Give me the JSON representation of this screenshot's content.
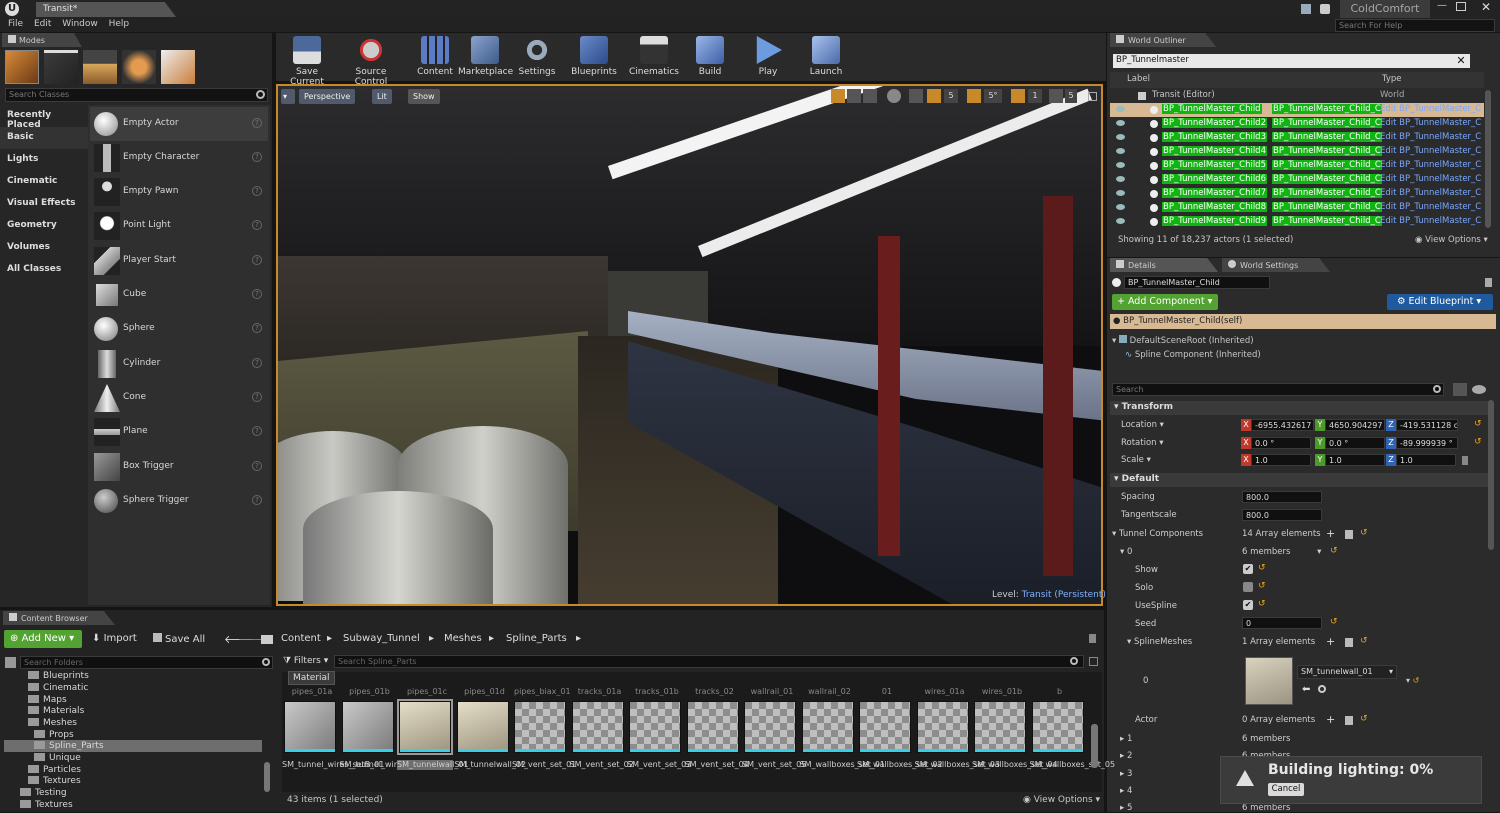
{
  "app": {
    "tab_title": "Transit*",
    "project_name": "ColdComfort",
    "search_help_placeholder": "Search For Help"
  },
  "menu": [
    "File",
    "Edit",
    "Window",
    "Help"
  ],
  "modes": {
    "tab": "Modes",
    "search_placeholder": "Search Classes",
    "categories": [
      "Recently Placed",
      "Basic",
      "Lights",
      "Cinematic",
      "Visual Effects",
      "Geometry",
      "Volumes",
      "All Classes"
    ],
    "selected_category": "Basic",
    "actors": [
      "Empty Actor",
      "Empty Character",
      "Empty Pawn",
      "Point Light",
      "Player Start",
      "Cube",
      "Sphere",
      "Cylinder",
      "Cone",
      "Plane",
      "Box Trigger",
      "Sphere Trigger"
    ]
  },
  "toolbar": [
    "Save Current",
    "Source Control",
    "Content",
    "Marketplace",
    "Settings",
    "Blueprints",
    "Cinematics",
    "Build",
    "Play",
    "Launch"
  ],
  "viewport": {
    "perspective": "Perspective",
    "lit": "Lit",
    "show": "Show",
    "grid_snap": "5",
    "rot_snap": "5°",
    "scale_snap": "1",
    "cam_speed": "5",
    "level_label": "Level:",
    "level_name": "Transit (Persistent)"
  },
  "outliner": {
    "tab": "World Outliner",
    "search_value": "BP_Tunnelmaster",
    "col_label": "Label",
    "col_type": "Type",
    "root_label": "Transit (Editor)",
    "root_type": "World",
    "rows": [
      {
        "name": "BP_TunnelMaster_Child",
        "type": "BP_TunnelMaster_Child_C",
        "edit": "Edit BP_TunnelMaster_C"
      },
      {
        "name": "BP_TunnelMaster_Child2",
        "type": "BP_TunnelMaster_Child_C",
        "edit": "Edit BP_TunnelMaster_C"
      },
      {
        "name": "BP_TunnelMaster_Child3",
        "type": "BP_TunnelMaster_Child_C",
        "edit": "Edit BP_TunnelMaster_C"
      },
      {
        "name": "BP_TunnelMaster_Child4",
        "type": "BP_TunnelMaster_Child_C",
        "edit": "Edit BP_TunnelMaster_C"
      },
      {
        "name": "BP_TunnelMaster_Child5",
        "type": "BP_TunnelMaster_Child_C",
        "edit": "Edit BP_TunnelMaster_C"
      },
      {
        "name": "BP_TunnelMaster_Child6",
        "type": "BP_TunnelMaster_Child_C",
        "edit": "Edit BP_TunnelMaster_C"
      },
      {
        "name": "BP_TunnelMaster_Child7",
        "type": "BP_TunnelMaster_Child_C",
        "edit": "Edit BP_TunnelMaster_C"
      },
      {
        "name": "BP_TunnelMaster_Child8",
        "type": "BP_TunnelMaster_Child_C",
        "edit": "Edit BP_TunnelMaster_C"
      },
      {
        "name": "BP_TunnelMaster_Child9",
        "type": "BP_TunnelMaster_Child_C",
        "edit": "Edit BP_TunnelMaster_C"
      }
    ],
    "status": "Showing 11 of 18,237 actors (1 selected)",
    "view_options": "View Options"
  },
  "details": {
    "tab": "Details",
    "tab2": "World Settings",
    "actor_name": "BP_TunnelMaster_Child",
    "add_component": "+ Add Component",
    "edit_blueprint": "Edit Blueprint",
    "self_label": "BP_TunnelMaster_Child(self)",
    "components": [
      "DefaultSceneRoot (Inherited)",
      "Spline Component (Inherited)"
    ],
    "search_placeholder": "Search",
    "transform_header": "Transform",
    "location_label": "Location",
    "rotation_label": "Rotation",
    "scale_label": "Scale",
    "location": [
      "-6955.432617",
      "4650.904297 c",
      "-419.531128 cr"
    ],
    "rotation": [
      "0.0 °",
      "0.0 °",
      "-89.999939 °"
    ],
    "scale": [
      "1.0",
      "1.0",
      "1.0"
    ],
    "default_header": "Default",
    "spacing_label": "Spacing",
    "spacing": "800.0",
    "tangentscale_label": "Tangentscale",
    "tangentscale": "800.0",
    "tunnel_components_label": "Tunnel Components",
    "tunnel_components_value": "14 Array elements",
    "index0": "0",
    "index0_value": "6 members",
    "show_label": "Show",
    "solo_label": "Solo",
    "usespline_label": "UseSpline",
    "seed_label": "Seed",
    "seed": "0",
    "splinemeshes_label": "SplineMeshes",
    "splinemeshes_value": "1 Array elements",
    "mesh_index": "0",
    "mesh_asset": "SM_tunnelwall_01",
    "actor_label": "Actor",
    "actor_value": "0 Array elements",
    "more_indices": [
      "1",
      "2",
      "3",
      "4",
      "5"
    ],
    "more_value": "6 members"
  },
  "content_browser": {
    "tab": "Content Browser",
    "add_new": "Add New",
    "import": "Import",
    "save_all": "Save All",
    "breadcrumb": [
      "Content",
      "Subway_Tunnel",
      "Meshes",
      "Spline_Parts"
    ],
    "search_folders_placeholder": "Search Folders",
    "folders": [
      "Blueprints",
      "Cinematic",
      "Maps",
      "Materials",
      "Meshes",
      "Props",
      "Spline_Parts",
      "Unique",
      "Particles",
      "Textures",
      "Testing",
      "Textures"
    ],
    "filters": "Filters",
    "search_assets_placeholder": "Search Spline_Parts",
    "material_tooltip": "Material",
    "top_row_labels": [
      "pipes_01a",
      "pipes_01b",
      "pipes_01c",
      "pipes_01d",
      "pipes_biax_01a",
      "tracks_01a",
      "tracks_01b",
      "tracks_02",
      "wallrail_01",
      "wallrail_02",
      "01",
      "wires_01a",
      "wires_01b",
      "b"
    ],
    "assets": [
      "SM_tunnel_wires_setB_01",
      "SM_tunnel_wires_setB_02",
      "SM_tunnelwall_01",
      "SM_tunnelwall_02",
      "SM_vent_set_01",
      "SM_vent_set_02",
      "SM_vent_set_03",
      "SM_vent_set_04",
      "SM_vent_set_05",
      "SM_wallboxes_set_01",
      "SM_wallboxes_set_02",
      "SM_wallboxes_set_03",
      "SM_wallboxes_set_04",
      "SM_wallboxes_set_05"
    ],
    "status": "43 items (1 selected)",
    "view_options": "View Options"
  },
  "notification": {
    "text": "Building lighting:  0%",
    "cancel": "Cancel"
  }
}
